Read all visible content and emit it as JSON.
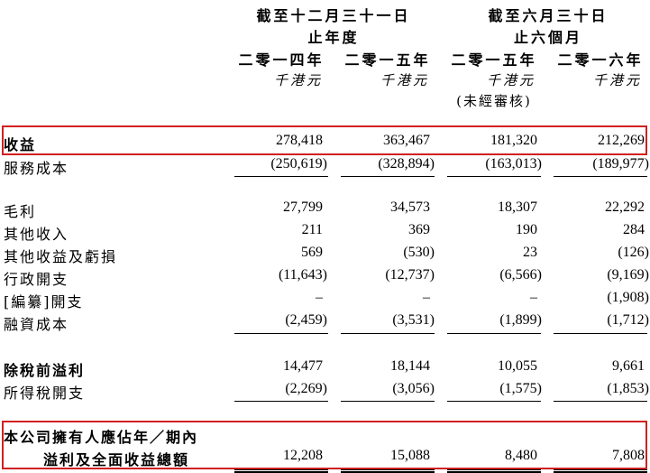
{
  "header": {
    "group1_line1": "截至十二月三十一日",
    "group1_line2": "止年度",
    "group2_line1": "截至六月三十日",
    "group2_line2": "止六個月",
    "columns": [
      "二零一四年",
      "二零一五年",
      "二零一五年",
      "二零一六年"
    ],
    "units": [
      "千港元",
      "千港元",
      "千港元",
      "千港元"
    ],
    "unaudited": "(未經審核)"
  },
  "rows": [
    {
      "label": "收益",
      "values": [
        "278,418",
        "363,467",
        "181,320",
        "212,269"
      ]
    },
    {
      "label": "服務成本",
      "values": [
        "(250,619)",
        "(328,894)",
        "(163,013)",
        "(189,977)"
      ]
    },
    {
      "label": "毛利",
      "values": [
        "27,799",
        "34,573",
        "18,307",
        "22,292"
      ]
    },
    {
      "label": "其他收入",
      "values": [
        "211",
        "369",
        "190",
        "284"
      ]
    },
    {
      "label": "其他收益及虧損",
      "values": [
        "569",
        "(530)",
        "23",
        "(126)"
      ]
    },
    {
      "label": "行政開支",
      "values": [
        "(11,643)",
        "(12,737)",
        "(6,566)",
        "(9,169)"
      ]
    },
    {
      "label": "[編纂]開支",
      "values": [
        "–",
        "–",
        "–",
        "(1,908)"
      ]
    },
    {
      "label": "融資成本",
      "values": [
        "(2,459)",
        "(3,531)",
        "(1,899)",
        "(1,712)"
      ]
    },
    {
      "label": "除稅前溢利",
      "values": [
        "14,477",
        "18,144",
        "10,055",
        "9,661"
      ]
    },
    {
      "label": "所得稅開支",
      "values": [
        "(2,269)",
        "(3,056)",
        "(1,575)",
        "(1,853)"
      ]
    },
    {
      "label": "本公司擁有人應佔年／期內",
      "values": [
        "",
        "",
        "",
        ""
      ]
    },
    {
      "label": "溢利及全面收益總額",
      "values": [
        "12,208",
        "15,088",
        "8,480",
        "7,808"
      ]
    }
  ],
  "colors": {
    "highlight": "#d0201f",
    "text": "#000000"
  }
}
